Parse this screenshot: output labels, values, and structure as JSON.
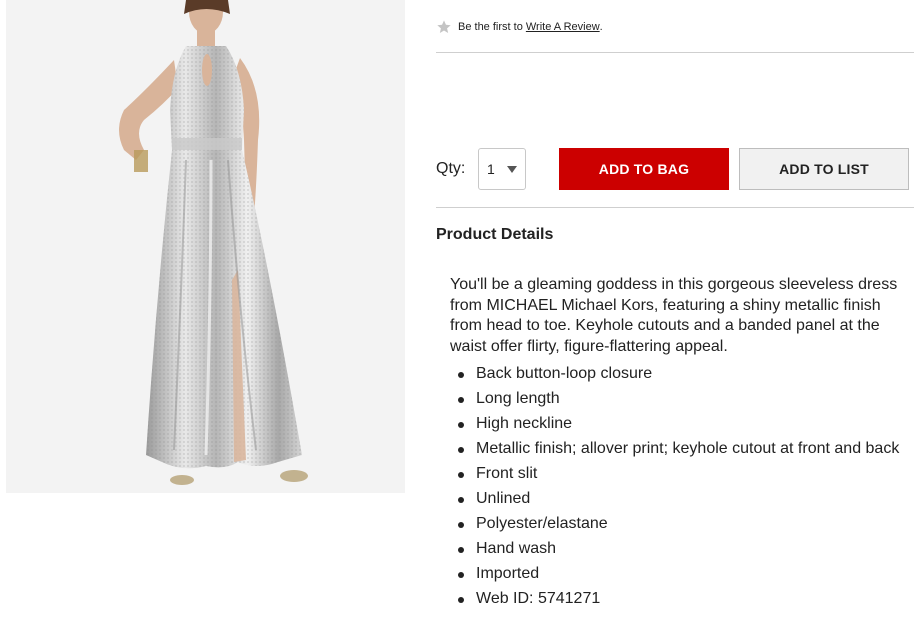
{
  "review": {
    "prefix": "Be the first to",
    "link": "Write A Review",
    "suffix": "."
  },
  "quantity": {
    "label": "Qty:",
    "value": "1"
  },
  "actions": {
    "add_to_bag": "ADD TO BAG",
    "add_to_list": "ADD TO LIST"
  },
  "details": {
    "title": "Product Details",
    "description": "You'll be a gleaming goddess in this gorgeous sleeveless dress from MICHAEL Michael Kors, featuring a shiny metallic finish from head to toe. Keyhole cutouts and a banded panel at the waist offer flirty, figure-flattering appeal.",
    "bullets": [
      "Back button-loop closure",
      "Long length",
      "High neckline",
      "Metallic finish; allover print; keyhole cutout at front and back",
      "Front slit",
      "Unlined",
      "Polyester/elastane",
      "Hand wash",
      "Imported",
      "Web ID: 5741271"
    ]
  },
  "colors": {
    "brand_red": "#cc0000",
    "list_button_bg": "#f1f1f1",
    "divider": "#cfcfcf"
  }
}
